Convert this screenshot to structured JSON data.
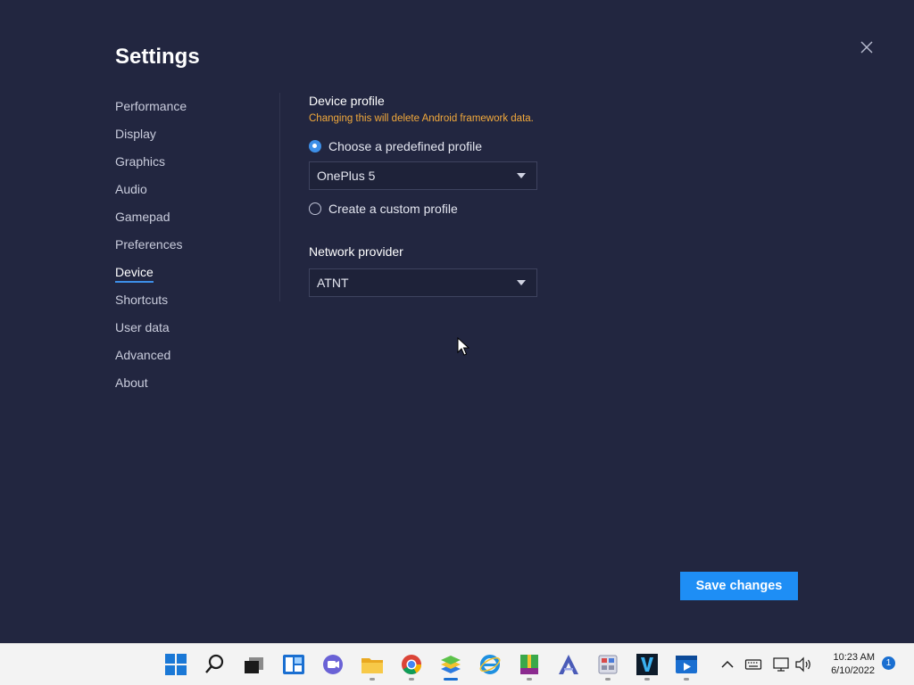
{
  "window": {
    "title": "Settings"
  },
  "nav": {
    "items": [
      {
        "label": "Performance"
      },
      {
        "label": "Display"
      },
      {
        "label": "Graphics"
      },
      {
        "label": "Audio"
      },
      {
        "label": "Gamepad"
      },
      {
        "label": "Preferences"
      },
      {
        "label": "Device",
        "active": true
      },
      {
        "label": "Shortcuts"
      },
      {
        "label": "User data"
      },
      {
        "label": "Advanced"
      },
      {
        "label": "About"
      }
    ]
  },
  "device_profile": {
    "title": "Device profile",
    "warning": "Changing this will delete Android framework data.",
    "option_predefined": "Choose a predefined profile",
    "option_predefined_checked": true,
    "profile_value": "OnePlus 5",
    "option_custom": "Create a custom profile",
    "option_custom_checked": false
  },
  "network": {
    "title": "Network provider",
    "value": "ATNT"
  },
  "actions": {
    "save_label": "Save changes"
  },
  "taskbar": {
    "apps": [
      "start-icon",
      "search-icon",
      "task-view-icon",
      "widgets-icon",
      "chat-icon",
      "file-explorer-icon",
      "chrome-icon",
      "bluestacks-icon",
      "internet-explorer-icon",
      "archive-icon",
      "app-a-icon",
      "app-calc-icon",
      "app-v-icon",
      "media-player-icon"
    ],
    "time": "10:23 AM",
    "date": "6/10/2022",
    "notification_count": "1"
  },
  "colors": {
    "background": "#222640",
    "accent": "#3d8fe8",
    "warning": "#f2a93b",
    "save_button": "#1e8ef5"
  }
}
